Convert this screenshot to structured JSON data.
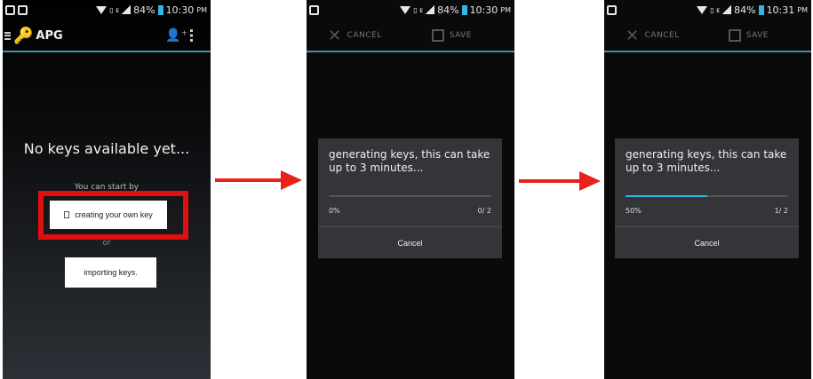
{
  "colors": {
    "arrow": "#e8211b",
    "accent": "#33b5e5",
    "highlight": "#e01010"
  },
  "screens": [
    {
      "status": {
        "battery": "84%",
        "time": "10:30",
        "ampm": "PM"
      },
      "app_title": "APG",
      "empty_title": "No keys available yet...",
      "start_hint": "You can start by",
      "create_label": "creating your own key",
      "or_label": "or",
      "import_label": "importing keys."
    },
    {
      "status": {
        "battery": "84%",
        "time": "10:30",
        "ampm": "PM"
      },
      "cancel_label": "CANCEL",
      "save_label": "SAVE",
      "dialog": {
        "message": "generating keys, this can take up to 3 minutes...",
        "progress_fraction": 0.0,
        "percent": "0%",
        "count": "0/ 2",
        "cancel": "Cancel"
      }
    },
    {
      "status": {
        "battery": "84%",
        "time": "10:31",
        "ampm": "PM"
      },
      "cancel_label": "CANCEL",
      "save_label": "SAVE",
      "dialog": {
        "message": "generating keys, this can take up to 3 minutes...",
        "progress_fraction": 0.5,
        "percent": "50%",
        "count": "1/ 2",
        "cancel": "Cancel"
      }
    }
  ]
}
